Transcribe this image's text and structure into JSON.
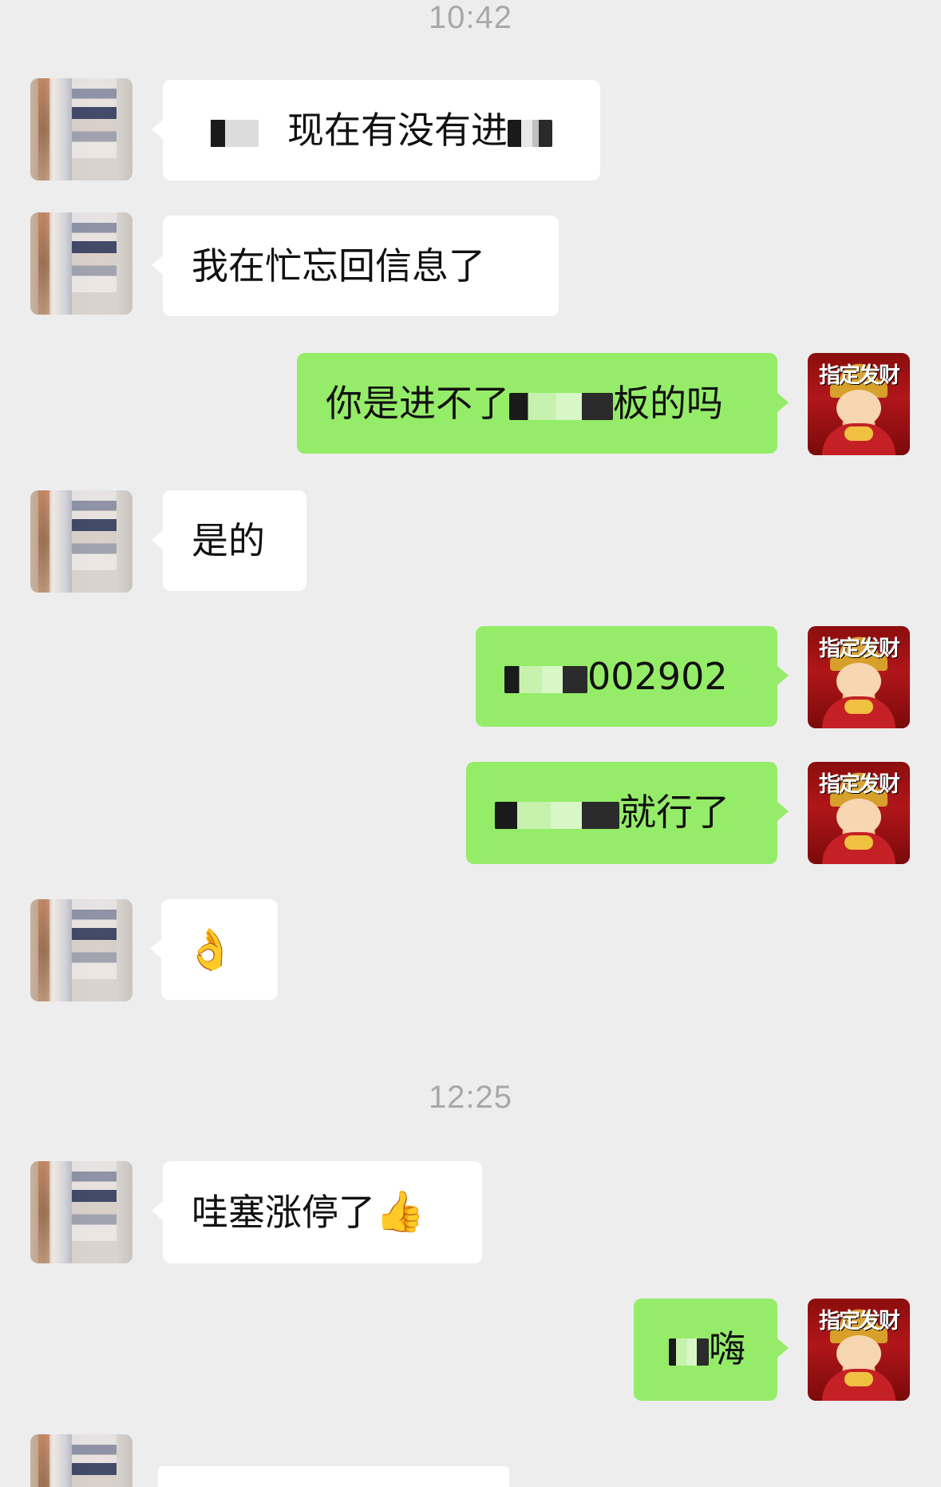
{
  "timestamps": [
    "10:42",
    "12:25"
  ],
  "messages": [
    {
      "side": "left",
      "text_suffix": "现在有没有进"
    },
    {
      "side": "left",
      "text": "我在忙忘回信息了"
    },
    {
      "side": "right",
      "text_prefix": "你是进不了",
      "text_suffix": "板的吗"
    },
    {
      "side": "left",
      "text": "是的"
    },
    {
      "side": "right",
      "text_suffix": "002902"
    },
    {
      "side": "right",
      "text_suffix": "就行了"
    },
    {
      "side": "left",
      "emoji": "👌"
    },
    {
      "side": "left",
      "text": "哇塞涨停了",
      "emoji": "👍"
    },
    {
      "side": "right",
      "text_suffix": "嗨"
    }
  ],
  "self_avatar_banner": "指定发财",
  "colors": {
    "background": "#EDEDED",
    "left_bubble": "#FFFFFF",
    "right_bubble": "#95EC69",
    "timestamp": "#A8A8A8"
  }
}
